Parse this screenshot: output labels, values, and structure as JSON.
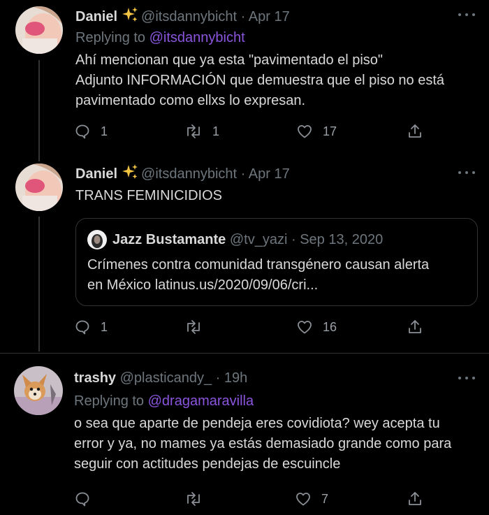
{
  "tweets": [
    {
      "name": "Daniel",
      "handle": "@itsdannybicht",
      "separator": "·",
      "time": "Apr 17",
      "reply_prefix": "Replying to",
      "reply_mention": "@itsdannybicht",
      "text": "Ahí mencionan que ya esta \"pavimentado el piso\"\nAdjunto INFORMACIÓN que demuestra que el piso no está\npavimentado como ellxs lo expresan.",
      "replies": "1",
      "retweets": "1",
      "likes": "17"
    },
    {
      "name": "Daniel",
      "handle": "@itsdannybicht",
      "separator": "·",
      "time": "Apr 17",
      "text": "TRANS FEMINICIDIOS",
      "quote": {
        "name": "Jazz Bustamante",
        "handle": "@tv_yazi",
        "separator": "·",
        "time": "Sep 13, 2020",
        "text": "Crímenes contra comunidad transgénero causan alerta\nen México latinus.us/2020/09/06/cri..."
      },
      "replies": "1",
      "retweets": "",
      "likes": "16"
    },
    {
      "name": "trashy",
      "handle": "@plasticandy_",
      "separator": "·",
      "time": "19h",
      "reply_prefix": "Replying to",
      "reply_mention": "@dragamaravilla",
      "text": "o sea que aparte de pendeja eres covidiota? wey acepta tu\nerror y ya, no mames ya estás demasiado grande como para\nseguir con actitudes pendejas de escuincle",
      "replies": "",
      "retweets": "",
      "likes": "7"
    }
  ],
  "icons": {
    "reply": "reply-icon",
    "retweet": "retweet-icon",
    "like": "heart-icon",
    "share": "share-icon",
    "more": "more-icon",
    "sparkles": "sparkles-icon"
  },
  "colors": {
    "background": "#000000",
    "text": "#d9d9d9",
    "muted": "#6e767d",
    "mention": "#8a55dc",
    "sparkle": "#f4c542",
    "border": "#2f3336"
  }
}
